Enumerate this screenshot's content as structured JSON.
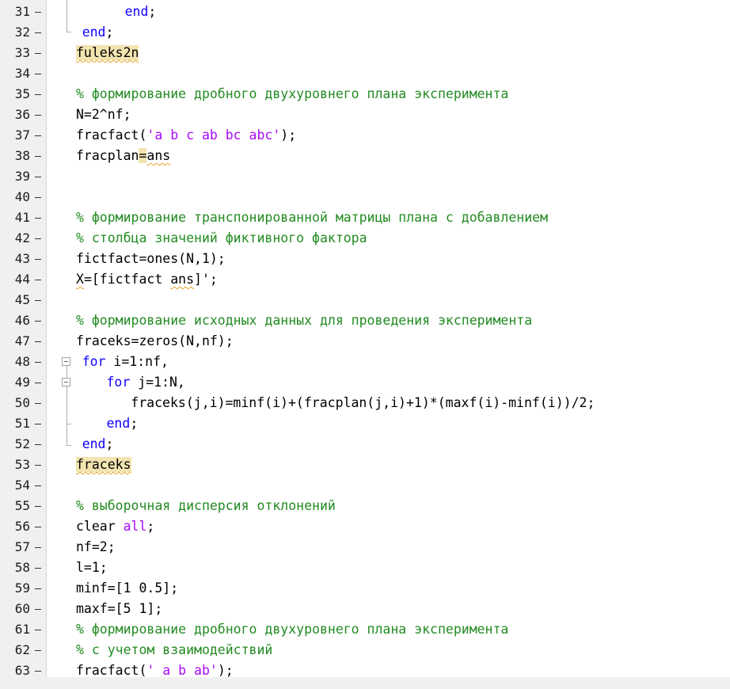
{
  "lines": [
    {
      "n": "31",
      "indent": 8,
      "t": [
        [
          "end",
          "kw"
        ],
        [
          ";",
          ""
        ]
      ]
    },
    {
      "n": "32",
      "indent": 1,
      "t": [
        [
          "end",
          "kw"
        ],
        [
          ";",
          ""
        ]
      ]
    },
    {
      "n": "33",
      "indent": 0,
      "t": [
        [
          "fuleks2n",
          "hl squig"
        ]
      ]
    },
    {
      "n": "34",
      "indent": 0,
      "t": []
    },
    {
      "n": "35",
      "indent": 0,
      "t": [
        [
          "% формирование дробного двухуровнего плана эксперимента",
          "cm"
        ]
      ]
    },
    {
      "n": "36",
      "indent": 0,
      "t": [
        [
          "N=2^nf;",
          ""
        ]
      ]
    },
    {
      "n": "37",
      "indent": 0,
      "t": [
        [
          "fracfact(",
          ""
        ],
        [
          "'a b c ab bc abc'",
          "str"
        ],
        [
          ");",
          ""
        ]
      ]
    },
    {
      "n": "38",
      "indent": 0,
      "t": [
        [
          "fracplan",
          ""
        ],
        [
          "=",
          "hl"
        ],
        [
          "ans",
          "squig"
        ]
      ]
    },
    {
      "n": "39",
      "indent": 0,
      "t": []
    },
    {
      "n": "40",
      "indent": 0,
      "t": []
    },
    {
      "n": "41",
      "indent": 0,
      "t": [
        [
          "% формирование транспонированной матрицы плана с добавлением",
          "cm"
        ]
      ]
    },
    {
      "n": "42",
      "indent": 0,
      "t": [
        [
          "% столбца значений фиктивного фактора",
          "cm"
        ]
      ]
    },
    {
      "n": "43",
      "indent": 0,
      "t": [
        [
          "fictfact=ones(N,1);",
          ""
        ]
      ]
    },
    {
      "n": "44",
      "indent": 0,
      "t": [
        [
          "X",
          "squig"
        ],
        [
          "=[fictfact ",
          ""
        ],
        [
          "ans",
          "squig"
        ],
        [
          "]';",
          ""
        ]
      ]
    },
    {
      "n": "45",
      "indent": 0,
      "t": []
    },
    {
      "n": "46",
      "indent": 0,
      "t": [
        [
          "% формирование исходных данных для проведения эксперимента",
          "cm"
        ]
      ]
    },
    {
      "n": "47",
      "indent": 0,
      "t": [
        [
          "fraceks=zeros(N,nf);",
          ""
        ]
      ]
    },
    {
      "n": "48",
      "indent": 1,
      "t": [
        [
          "for",
          "kw"
        ],
        [
          " i=1:nf,",
          ""
        ]
      ]
    },
    {
      "n": "49",
      "indent": 5,
      "t": [
        [
          "for",
          "kw"
        ],
        [
          " j=1:N,",
          ""
        ]
      ]
    },
    {
      "n": "50",
      "indent": 9,
      "t": [
        [
          "fraceks(j,i)=minf(i)+(fracplan(j,i)+1)*(maxf(i)-minf(i))/2;",
          ""
        ]
      ]
    },
    {
      "n": "51",
      "indent": 5,
      "t": [
        [
          "end",
          "kw"
        ],
        [
          ";",
          ""
        ]
      ]
    },
    {
      "n": "52",
      "indent": 1,
      "t": [
        [
          "end",
          "kw"
        ],
        [
          ";",
          ""
        ]
      ]
    },
    {
      "n": "53",
      "indent": 0,
      "t": [
        [
          "fraceks",
          "hl squig"
        ]
      ]
    },
    {
      "n": "54",
      "indent": 0,
      "t": []
    },
    {
      "n": "55",
      "indent": 0,
      "t": [
        [
          "% выборочная дисперсия отклонений",
          "cm"
        ]
      ]
    },
    {
      "n": "56",
      "indent": 0,
      "t": [
        [
          "clear ",
          ""
        ],
        [
          "all",
          "str"
        ],
        [
          ";",
          ""
        ]
      ]
    },
    {
      "n": "57",
      "indent": 0,
      "t": [
        [
          "nf=2;",
          ""
        ]
      ]
    },
    {
      "n": "58",
      "indent": 0,
      "t": [
        [
          "l=1;",
          ""
        ]
      ]
    },
    {
      "n": "59",
      "indent": 0,
      "t": [
        [
          "minf=[1 0.5];",
          ""
        ]
      ]
    },
    {
      "n": "60",
      "indent": 0,
      "t": [
        [
          "maxf=[5 1];",
          ""
        ]
      ]
    },
    {
      "n": "61",
      "indent": 0,
      "t": [
        [
          "% формирование дробного двухуровнего плана эксперимента",
          "cm"
        ]
      ]
    },
    {
      "n": "62",
      "indent": 0,
      "t": [
        [
          "% с учетом взаимодействий",
          "cm"
        ]
      ]
    },
    {
      "n": "63",
      "indent": 0,
      "t": [
        [
          "fracfact(",
          ""
        ],
        [
          "' a b ab'",
          "str"
        ],
        [
          ");",
          ""
        ]
      ]
    }
  ]
}
